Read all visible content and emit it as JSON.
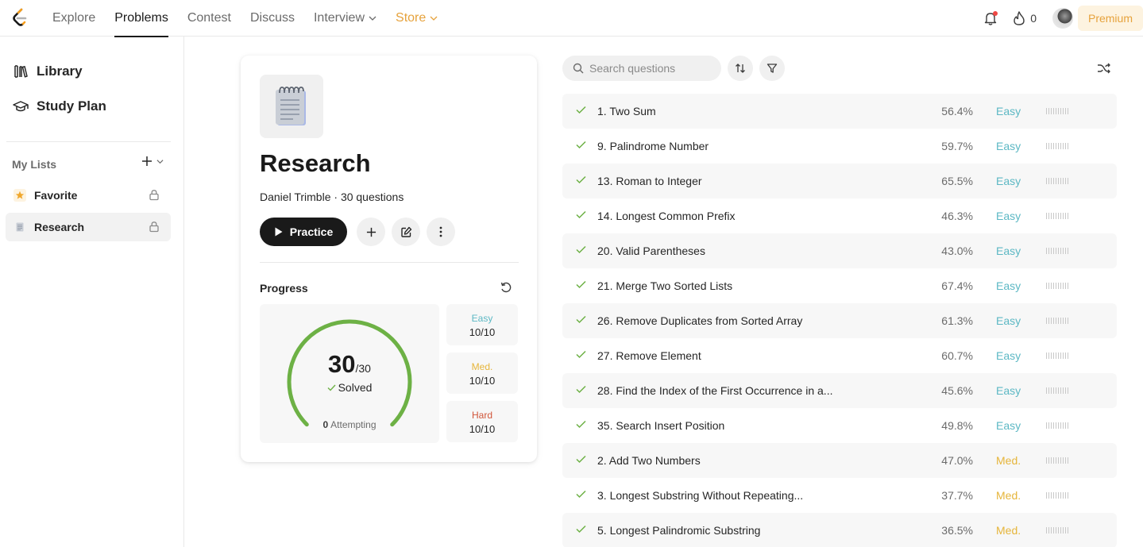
{
  "nav": {
    "items": [
      {
        "label": "Explore"
      },
      {
        "label": "Problems"
      },
      {
        "label": "Contest"
      },
      {
        "label": "Discuss"
      },
      {
        "label": "Interview"
      },
      {
        "label": "Store"
      }
    ],
    "active": "Problems",
    "streak_count": "0",
    "premium_label": "Premium"
  },
  "sidebar": {
    "library_label": "Library",
    "studyplan_label": "Study Plan",
    "mylists_title": "My Lists",
    "lists": [
      {
        "label": "Favorite",
        "icon": "star-icon"
      },
      {
        "label": "Research",
        "icon": "notepad-icon",
        "selected": true
      }
    ]
  },
  "card": {
    "title": "Research",
    "owner": "Daniel Trimble",
    "question_count": "30 questions",
    "practice_label": "Practice",
    "progress_title": "Progress",
    "solved": "30",
    "total": "/30",
    "solved_label": "Solved",
    "attempting_count": "0",
    "attempting_label": "Attempting",
    "solved_fraction": 1.0,
    "difficulty": [
      {
        "label": "Easy",
        "value": "10/10",
        "color": "#5cb8c4"
      },
      {
        "label": "Med.",
        "value": "10/10",
        "color": "#e6b53a"
      },
      {
        "label": "Hard",
        "value": "10/10",
        "color": "#d1563a"
      }
    ],
    "gauge_color": "#6db145"
  },
  "questions": {
    "search_placeholder": "Search questions",
    "rows": [
      {
        "title": "1. Two Sum",
        "acceptance": "56.4%",
        "difficulty": "Easy"
      },
      {
        "title": "9. Palindrome Number",
        "acceptance": "59.7%",
        "difficulty": "Easy"
      },
      {
        "title": "13. Roman to Integer",
        "acceptance": "65.5%",
        "difficulty": "Easy"
      },
      {
        "title": "14. Longest Common Prefix",
        "acceptance": "46.3%",
        "difficulty": "Easy"
      },
      {
        "title": "20. Valid Parentheses",
        "acceptance": "43.0%",
        "difficulty": "Easy"
      },
      {
        "title": "21. Merge Two Sorted Lists",
        "acceptance": "67.4%",
        "difficulty": "Easy"
      },
      {
        "title": "26. Remove Duplicates from Sorted Array",
        "acceptance": "61.3%",
        "difficulty": "Easy"
      },
      {
        "title": "27. Remove Element",
        "acceptance": "60.7%",
        "difficulty": "Easy"
      },
      {
        "title": "28. Find the Index of the First Occurrence in a...",
        "acceptance": "45.6%",
        "difficulty": "Easy"
      },
      {
        "title": "35. Search Insert Position",
        "acceptance": "49.8%",
        "difficulty": "Easy"
      },
      {
        "title": "2. Add Two Numbers",
        "acceptance": "47.0%",
        "difficulty": "Med."
      },
      {
        "title": "3. Longest Substring Without Repeating...",
        "acceptance": "37.7%",
        "difficulty": "Med."
      },
      {
        "title": "5. Longest Palindromic Substring",
        "acceptance": "36.5%",
        "difficulty": "Med."
      }
    ]
  },
  "colors": {
    "easy": "#5cb8c4",
    "medium": "#e6b53a",
    "hard": "#d1563a",
    "check": "#6db145",
    "store": "#e6a23c"
  }
}
